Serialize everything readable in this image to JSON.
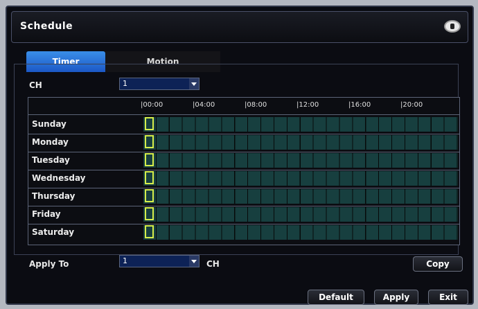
{
  "window": {
    "title": "Schedule"
  },
  "tabs": [
    {
      "label": "Timer",
      "active": true
    },
    {
      "label": "Motion",
      "active": false
    }
  ],
  "channel": {
    "label": "CH",
    "value": "1"
  },
  "time_labels": [
    "|00:00",
    "|04:00",
    "|08:00",
    "|12:00",
    "|16:00",
    "|20:00"
  ],
  "days": [
    "Sunday",
    "Monday",
    "Tuesday",
    "Wednesday",
    "Thursday",
    "Friday",
    "Saturday"
  ],
  "apply_to": {
    "label": "Apply  To",
    "value": "1",
    "unit": "CH"
  },
  "buttons": {
    "copy": "Copy",
    "default": "Default",
    "apply": "Apply",
    "exit": "Exit"
  },
  "colors": {
    "accent": "#1c58c6",
    "cell": "#173f3f",
    "cursor": "#d6ee4a"
  }
}
